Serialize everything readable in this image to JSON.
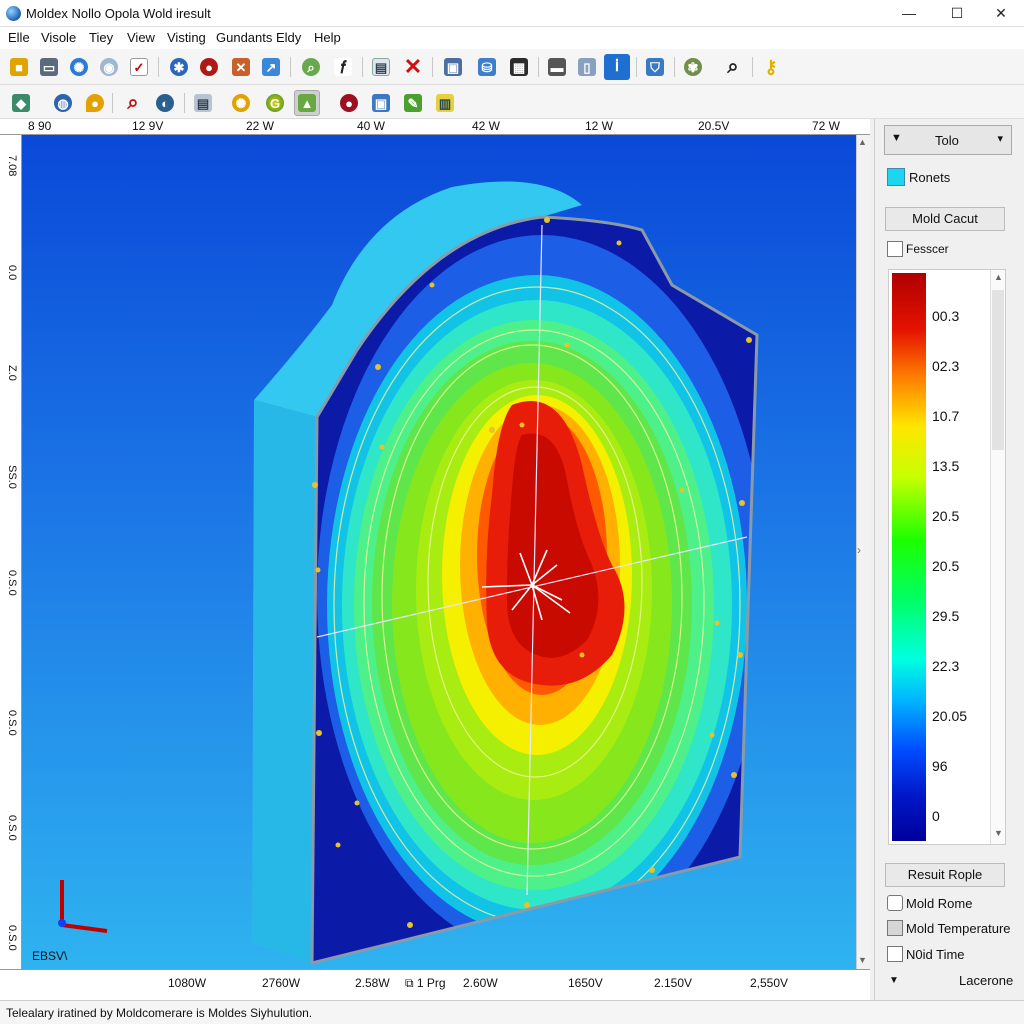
{
  "window": {
    "title": "Moldex Nollo Opola Wold iresult",
    "min": "—",
    "max": "☐",
    "close": "✕"
  },
  "menu": [
    "Elle",
    "Visole",
    "Tiey",
    "View",
    "Visting",
    "Gundants",
    "Eldy",
    "Help"
  ],
  "ruler": {
    "top": [
      "8 90",
      "12 9V",
      "22 W",
      "40 W",
      "42 W",
      "12 W",
      "20.5V",
      "72 W"
    ],
    "bottom": [
      "1080W",
      "2760W",
      "2.58W",
      "1 Prg",
      "2.60W",
      "1650V",
      "2.150V",
      "2,550V"
    ],
    "left": [
      "7.08",
      "0.0",
      "Z.0",
      "SS.0",
      "0.S.0",
      "0.S.0",
      "0.S.0",
      "0.S.0"
    ],
    "corner_bl": "EBSV\\"
  },
  "side": {
    "combo": {
      "value": "Tolo",
      "left_glyph": "▼",
      "right_glyph": "▾"
    },
    "ronets_label": "Ronets",
    "mold_cacut_button": "Mold Cacut",
    "fesscr_label": "Fesscer",
    "legend_values": [
      "00.3",
      "02.3",
      "10.7",
      "13.5",
      "20.5",
      "20.5",
      "29.5",
      "22.3",
      "20.05",
      "96",
      "0"
    ],
    "result_button": "Resuit Rople",
    "options": [
      "Mold Rome",
      "Mold Temperature",
      "N0id Time"
    ],
    "bottom_label": "Lacerone"
  },
  "status": {
    "text": "Telealary iratined by Moldcomerare is Moldes Siyhulution."
  },
  "icons": {
    "toolbar1": [
      "folder-icon",
      "window-icon",
      "gear-globe-icon",
      "disc-icon",
      "check-icon",
      "atom-icon",
      "red-sphere-icon",
      "tool-icon",
      "cursor-icon",
      "search-green-icon",
      "function-icon",
      "document-icon",
      "close-red-icon",
      "lock-icon",
      "database-icon",
      "grid-icon",
      "flag-icon",
      "terminal-icon",
      "info-icon",
      "shield-icon",
      "spiral-icon",
      "search-icon",
      "key-icon"
    ],
    "toolbar2": [
      "mesh-icon",
      "globe-icon",
      "pin-icon",
      "zoom-icon",
      "sphere-icon",
      "print-icon",
      "sun-icon",
      "gradient-sphere-icon",
      "flask-icon",
      "red-ball-icon",
      "cube-icon",
      "pen-icon",
      "chart-icon"
    ]
  },
  "colors": {
    "accent": "#1e6fd0",
    "viewport_top": "#0a49d8",
    "viewport_bottom": "#2fb3f0"
  }
}
